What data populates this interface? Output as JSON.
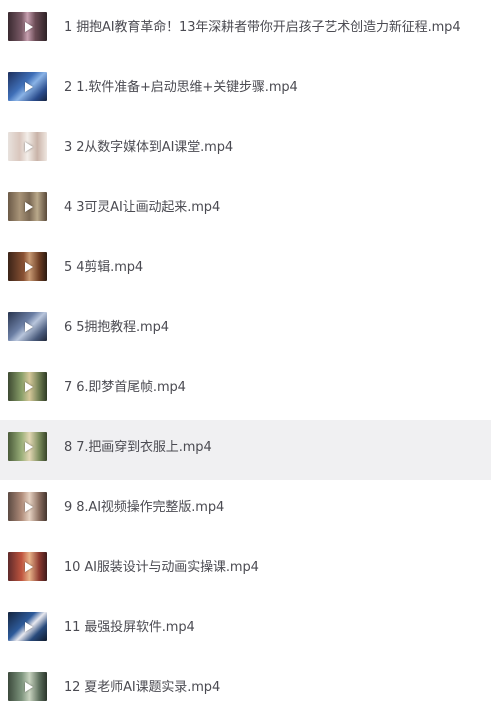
{
  "files": [
    {
      "label": "1 拥抱AI教育革命！13年深耕者带你开启孩子艺术创造力新征程.mp4",
      "thumbnail_icon": "video-thumbnail",
      "highlighted": false
    },
    {
      "label": "2 1.软件准备+启动思维+关键步骤.mp4",
      "thumbnail_icon": "video-thumbnail",
      "highlighted": false
    },
    {
      "label": "3 2从数字媒体到AI课堂.mp4",
      "thumbnail_icon": "video-thumbnail",
      "highlighted": false
    },
    {
      "label": "4 3可灵AI让画动起来.mp4",
      "thumbnail_icon": "video-thumbnail",
      "highlighted": false
    },
    {
      "label": "5 4剪辑.mp4",
      "thumbnail_icon": "video-thumbnail",
      "highlighted": false
    },
    {
      "label": "6 5拥抱教程.mp4",
      "thumbnail_icon": "video-thumbnail",
      "highlighted": false
    },
    {
      "label": "7 6.即梦首尾帧.mp4",
      "thumbnail_icon": "video-thumbnail",
      "highlighted": false
    },
    {
      "label": "8 7.把画穿到衣服上.mp4",
      "thumbnail_icon": "video-thumbnail",
      "highlighted": true
    },
    {
      "label": "9 8.AI视频操作完整版.mp4",
      "thumbnail_icon": "video-thumbnail",
      "highlighted": false
    },
    {
      "label": "10 AI服装设计与动画实操课.mp4",
      "thumbnail_icon": "video-thumbnail",
      "highlighted": false
    },
    {
      "label": "11 最强投屏软件.mp4",
      "thumbnail_icon": "video-thumbnail",
      "highlighted": false
    },
    {
      "label": "12 夏老师AI课题实录.mp4",
      "thumbnail_icon": "video-thumbnail",
      "highlighted": false
    }
  ],
  "colors": {
    "text": "#4b4b52",
    "highlight_bg": "#f0f0f2",
    "background": "#ffffff"
  }
}
